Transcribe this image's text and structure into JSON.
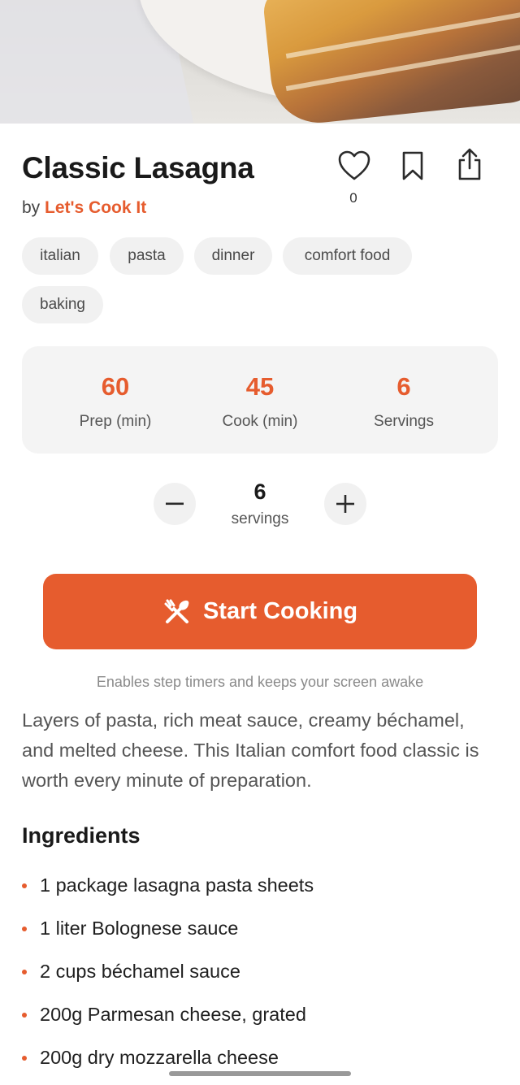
{
  "recipe": {
    "title": "Classic Lasagna",
    "by_prefix": "by",
    "author": "Let's Cook It",
    "like_count": "0"
  },
  "actions": {
    "like_icon": "heart-icon",
    "bookmark_icon": "bookmark-icon",
    "share_icon": "share-icon"
  },
  "tags": [
    "italian",
    "pasta",
    "dinner",
    "comfort food",
    "baking"
  ],
  "stats": [
    {
      "value": "60",
      "label": "Prep (min)"
    },
    {
      "value": "45",
      "label": "Cook (min)"
    },
    {
      "value": "6",
      "label": "Servings"
    }
  ],
  "stepper": {
    "minus": "−",
    "plus": "+",
    "value": "6",
    "label": "servings"
  },
  "start_button": {
    "label": "Start Cooking",
    "icon": "utensils-icon",
    "hint": "Enables step timers and keeps your screen awake"
  },
  "description": "Layers of pasta, rich meat sauce, creamy béchamel, and melted cheese. This Italian comfort food classic is worth every minute of preparation.",
  "ingredients_section": {
    "title": "Ingredients",
    "items": [
      "1 package lasagna pasta sheets",
      "1 liter Bolognese sauce",
      "2 cups béchamel sauce",
      "200g Parmesan cheese, grated",
      "200g dry mozzarella cheese"
    ]
  },
  "colors": {
    "accent": "#e65c2e",
    "chip_bg": "#f1f1f1",
    "stats_bg": "#f4f4f4"
  }
}
